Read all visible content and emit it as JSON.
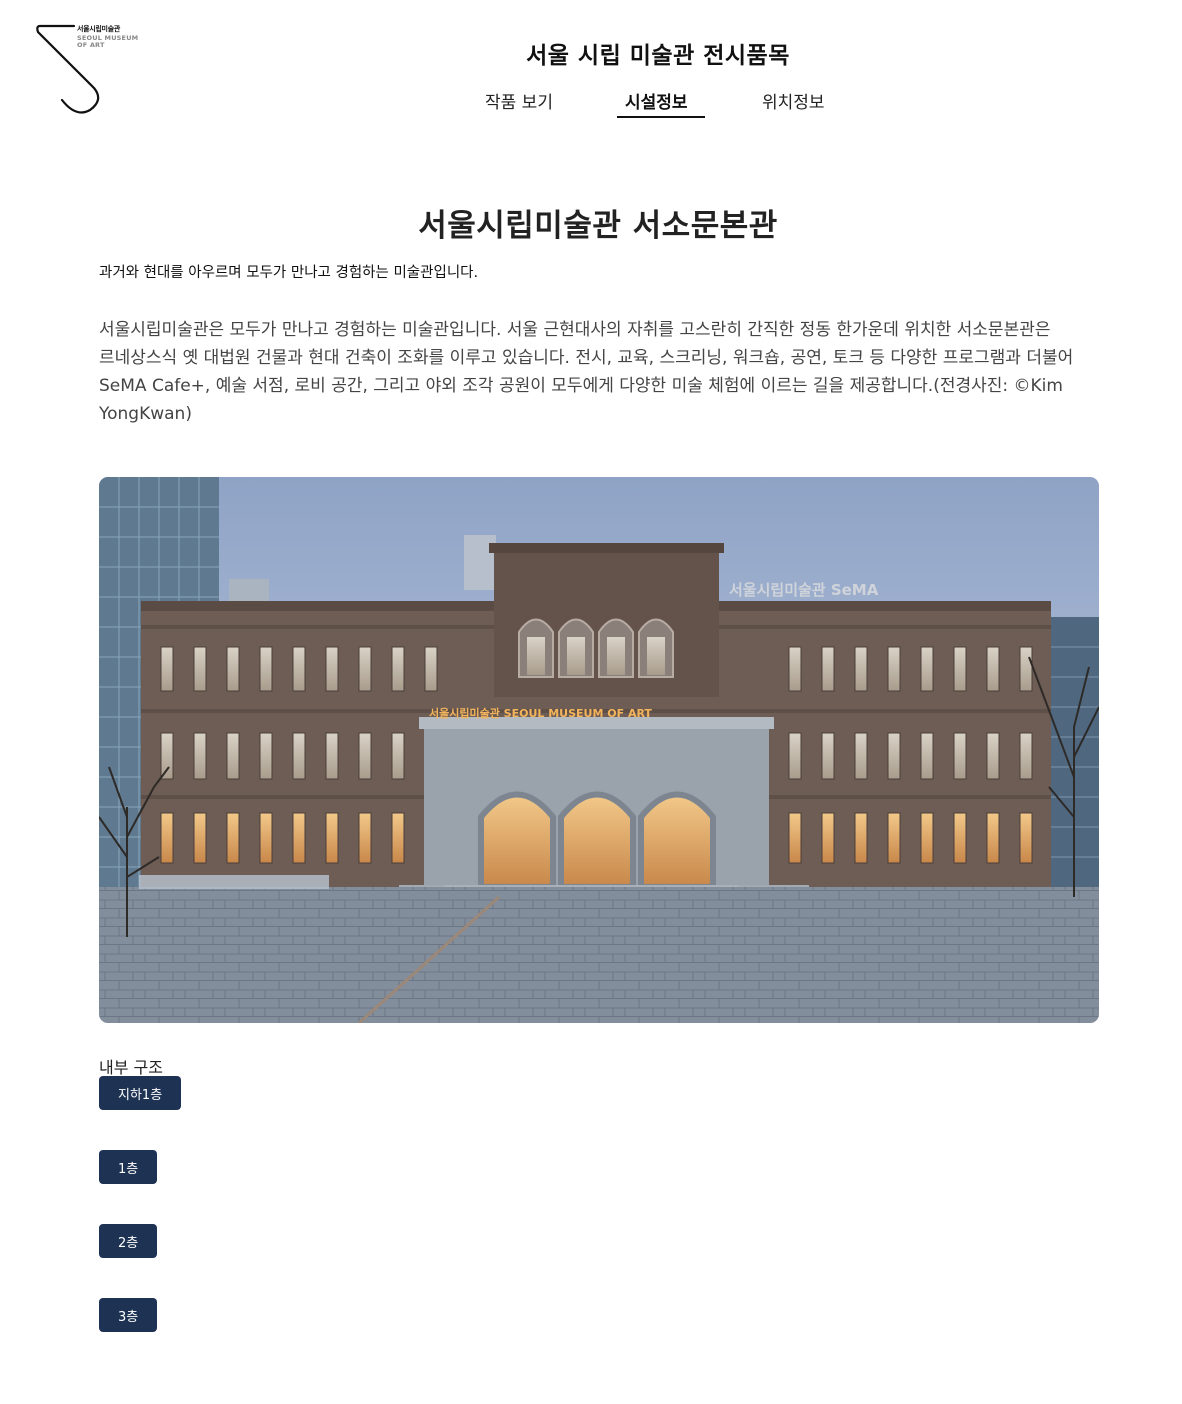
{
  "header": {
    "logo_text_kr": "서울시립미술관",
    "logo_text_en": "SEOUL MUSEUM\nOF ART",
    "site_title": "서울 시립 미술관 전시품목",
    "nav": [
      {
        "label": "작품 보기",
        "active": false
      },
      {
        "label": "시설정보",
        "active": true
      },
      {
        "label": "위치정보",
        "active": false
      }
    ]
  },
  "main": {
    "title": "서울시립미술관 서소문본관",
    "subtitle": "과거와 현대를 아우르며 모두가 만나고 경험하는 미술관입니다.",
    "description": "서울시립미술관은 모두가 만나고 경험하는 미술관입니다. 서울 근현대사의 자취를 고스란히 간직한 정동 한가운데 위치한 서소문본관은 르네상스식 옛 대법원 건물과 현대 건축이 조화를 이루고 있습니다. 전시, 교육, 스크리닝, 워크숍, 공연, 토크 등 다양한 프로그램과 더불어 SeMA Cafe+, 예술 서점, 로비 공간, 그리고 야외 조각 공원이 모두에게 다양한 미술 체험에 이르는 길을 제공합니다.(전경사진: ©Kim YongKwan)",
    "photo": {
      "facade_sign": "서울시립미술관 SEOUL MUSEUM OF ART",
      "roof_sign": "서울시립미술관 SeMA"
    },
    "structure_label": "내부 구조",
    "floors": [
      "지하1층",
      "1층",
      "2층",
      "3층"
    ]
  },
  "colors": {
    "button_bg": "#1e3353",
    "button_text": "#ffffff",
    "accent": "#111111"
  }
}
